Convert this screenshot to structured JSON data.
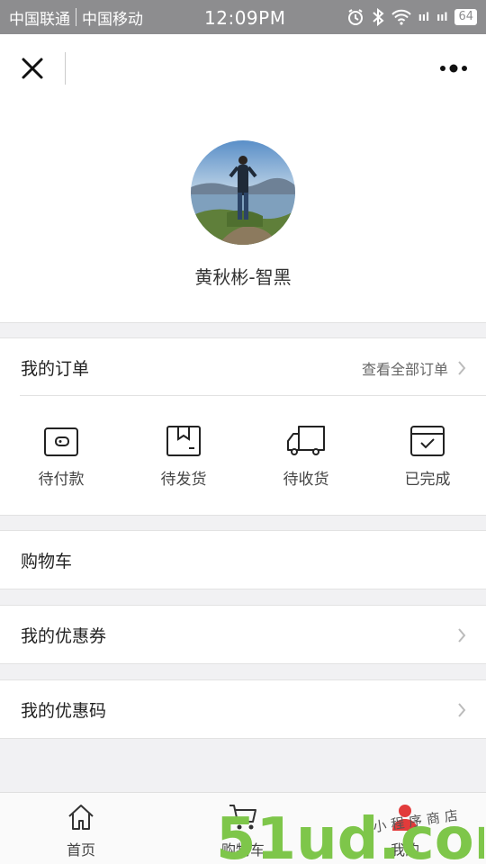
{
  "status_bar": {
    "carrier1": "中国联通",
    "carrier2": "中国移动",
    "time": "12:09PM",
    "battery": "64",
    "signal1": "ııl",
    "signal2": "ııl"
  },
  "navbar": {
    "close_icon": "close-icon",
    "more_icon": "more-dots-icon"
  },
  "profile": {
    "username": "黄秋彬-智黑",
    "avatar": "avatar-photo"
  },
  "orders": {
    "title": "我的订单",
    "view_all": "查看全部订单",
    "statuses": [
      {
        "label": "待付款",
        "icon": "wallet-icon"
      },
      {
        "label": "待发货",
        "icon": "package-icon"
      },
      {
        "label": "待收货",
        "icon": "truck-icon"
      },
      {
        "label": "已完成",
        "icon": "check-box-icon"
      }
    ]
  },
  "menu": {
    "cart": "购物车",
    "coupons": "我的优惠券",
    "codes": "我的优惠码"
  },
  "tabbar": {
    "items": [
      {
        "label": "首页",
        "icon": "home-icon"
      },
      {
        "label": "购物车",
        "icon": "cart-icon"
      },
      {
        "label": "我的",
        "icon": "user-icon"
      }
    ]
  },
  "watermark": {
    "brand": "51ud.com",
    "tagline": "小程序商店"
  },
  "colors": {
    "status_bar": "#8d8d8f",
    "page_bg": "#f1f1f3",
    "watermark_green": "#7ec64a",
    "watermark_red": "#e23b3b"
  }
}
